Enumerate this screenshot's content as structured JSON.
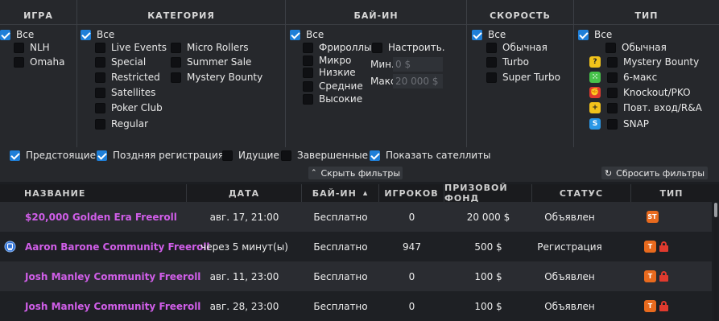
{
  "filters": {
    "game": {
      "header": "ИГРА",
      "options": [
        {
          "label": "Все",
          "checked": true
        },
        {
          "label": "NLH",
          "checked": false
        },
        {
          "label": "Omaha",
          "checked": false
        }
      ]
    },
    "category": {
      "header": "КАТЕГОРИЯ",
      "options": [
        {
          "label": "Все",
          "checked": true
        },
        {
          "label": "Live Events",
          "checked": false
        },
        {
          "label": "Special",
          "checked": false
        },
        {
          "label": "Restricted",
          "checked": false
        },
        {
          "label": "Satellites",
          "checked": false
        },
        {
          "label": "Poker Club",
          "checked": false
        },
        {
          "label": "Regular",
          "checked": false
        },
        {
          "label": "Micro Rollers",
          "checked": false
        },
        {
          "label": "Summer Sale",
          "checked": false
        },
        {
          "label": "Mystery Bounty",
          "checked": false
        }
      ]
    },
    "buyin": {
      "header": "БАЙ-ИН",
      "options": [
        {
          "label": "Все",
          "checked": true
        },
        {
          "label": "Фрироллы",
          "checked": false
        },
        {
          "label": "Микро",
          "checked": false
        },
        {
          "label": "Низкие",
          "checked": false
        },
        {
          "label": "Средние",
          "checked": false
        },
        {
          "label": "Высокие",
          "checked": false
        }
      ],
      "custom": {
        "label": "Настроить.",
        "checked": false
      },
      "min_label": "Мин.",
      "min_placeholder": "0 $",
      "max_label": "Макс.",
      "max_placeholder": "20 000 $"
    },
    "speed": {
      "header": "СКОРОСТЬ",
      "options": [
        {
          "label": "Все",
          "checked": true
        },
        {
          "label": "Обычная",
          "checked": false
        },
        {
          "label": "Turbo",
          "checked": false
        },
        {
          "label": "Super Turbo",
          "checked": false
        }
      ]
    },
    "type": {
      "header": "ТИП",
      "options": [
        {
          "label": "Все",
          "checked": true
        },
        {
          "label": "Обычная",
          "checked": false,
          "icon": null
        },
        {
          "label": "Mystery Bounty",
          "checked": false,
          "icon": "question-icon",
          "icon_color": "#f2c31b",
          "glyph": "?"
        },
        {
          "label": "6-макс",
          "checked": false,
          "icon": "six-max-icon",
          "icon_color": "#46c24a",
          "glyph": "⁙"
        },
        {
          "label": "Knockout/PKO",
          "checked": false,
          "icon": "knockout-icon",
          "icon_color": "#e0392f",
          "glyph": "✊"
        },
        {
          "label": "Повт. вход/R&A",
          "checked": false,
          "icon": "reentry-icon",
          "icon_color": "#f2c31b",
          "glyph": "+"
        },
        {
          "label": "SNAP",
          "checked": false,
          "icon": "snap-icon",
          "icon_color": "#2a97e6",
          "glyph": "S"
        }
      ]
    },
    "status_options": [
      {
        "label": "Предстоящие",
        "checked": true
      },
      {
        "label": "Поздняя регистрация",
        "checked": true
      },
      {
        "label": "Идущие",
        "checked": false
      },
      {
        "label": "Завершенные",
        "checked": false
      },
      {
        "label": "Показать сателлиты",
        "checked": true
      }
    ],
    "hide_button": "Скрыть фильтры",
    "reset_button": "Сбросить фильтры"
  },
  "table": {
    "columns": [
      "НАЗВАНИЕ",
      "ДАТА",
      "БАЙ-ИН",
      "ИГРОКОВ",
      "ПРИЗОВОЙ ФОНД",
      "СТАТУС",
      "ТИП"
    ],
    "sort_indicator": "▲",
    "rows": [
      {
        "name": "$20,000 Golden Era Freeroll",
        "date": "авг. 17, 21:00",
        "buyin": "Бесплатно",
        "players": "0",
        "prize": "20 000 $",
        "status": "Объявлен",
        "badge": "ST",
        "locked": false,
        "registered_icon": false
      },
      {
        "name": "Aaron Barone Community Freeroll",
        "date": "через 5 минут(ы)",
        "buyin": "Бесплатно",
        "players": "947",
        "prize": "500 $",
        "status": "Регистрация",
        "badge": "T",
        "locked": true,
        "registered_icon": true
      },
      {
        "name": "Josh Manley Community Freeroll",
        "date": "авг. 11, 23:00",
        "buyin": "Бесплатно",
        "players": "0",
        "prize": "100 $",
        "status": "Объявлен",
        "badge": "T",
        "locked": true,
        "registered_icon": false
      },
      {
        "name": "Josh Manley Community Freeroll",
        "date": "авг. 28, 23:00",
        "buyin": "Бесплатно",
        "players": "0",
        "prize": "100 $",
        "status": "Объявлен",
        "badge": "T",
        "locked": true,
        "registered_icon": false
      }
    ]
  },
  "colors": {
    "accent": "#1f7fd8",
    "tournament_name": "#d05ee8",
    "badge": "#e86a1e",
    "lock": "#e03a2e"
  }
}
